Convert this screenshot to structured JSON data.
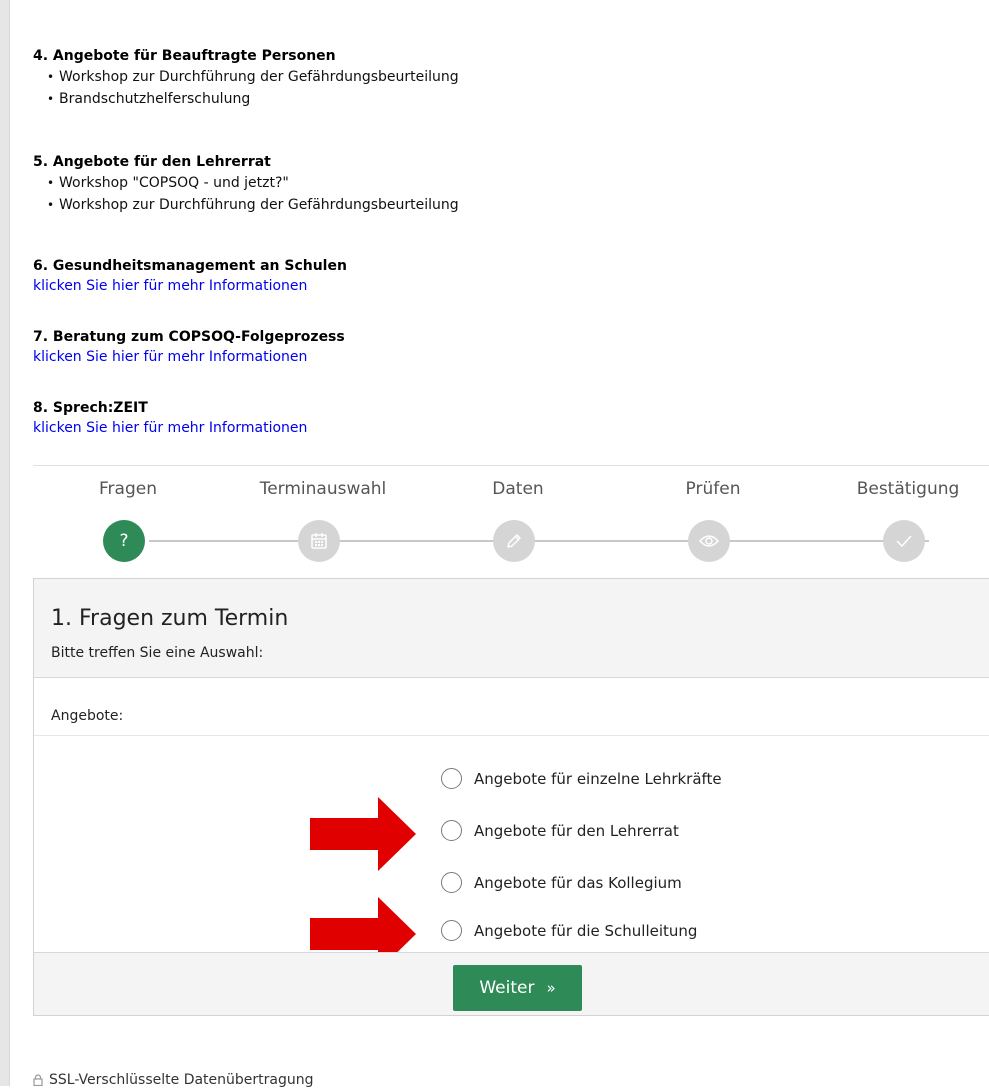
{
  "sections": [
    {
      "number_title": "4. Angebote für Beauftragte Personen",
      "items": [
        "Workshop zur Durchführung der Gefährdungsbeurteilung",
        "Brandschutzhelferschulung"
      ]
    },
    {
      "number_title": "5. Angebote für den Lehrerrat",
      "items": [
        "Workshop \"COPSOQ - und jetzt?\"",
        "Workshop zur Durchführung der Gefährdungsbeurteilung"
      ]
    },
    {
      "number_title": "6. Gesundheitsmanagement an Schulen",
      "link": "klicken Sie hier für mehr Informationen"
    },
    {
      "number_title": "7. Beratung zum COPSOQ-Folgeprozess",
      "link": "klicken Sie hier für mehr Informationen"
    },
    {
      "number_title": "8. Sprech:ZEIT",
      "link": "klicken Sie hier für mehr Informationen"
    }
  ],
  "wizard": {
    "steps": [
      {
        "label": "Fragen",
        "icon": "question-icon",
        "active": true
      },
      {
        "label": "Terminauswahl",
        "icon": "calendar-icon",
        "active": false
      },
      {
        "label": "Daten",
        "icon": "pencil-icon",
        "active": false
      },
      {
        "label": "Prüfen",
        "icon": "eye-icon",
        "active": false
      },
      {
        "label": "Bestätigung",
        "icon": "check-icon",
        "active": false
      }
    ],
    "active_color": "#2e8b57",
    "inactive_color": "#d5d5d5"
  },
  "panel": {
    "title": "1. Fragen zum Termin",
    "subtitle": "Bitte treffen Sie eine Auswahl:",
    "field_label": "Angebote:",
    "options": [
      "Angebote für einzelne Lehrkräfte",
      "Angebote für den Lehrerrat",
      "Angebote für das Kollegium",
      "Angebote für die Schulleitung"
    ],
    "next_button": "Weiter",
    "next_icon": "»"
  },
  "footer": {
    "ssl_text": "SSL-Verschlüsselte Datenübertragung"
  },
  "annotation_color": "#e00000"
}
